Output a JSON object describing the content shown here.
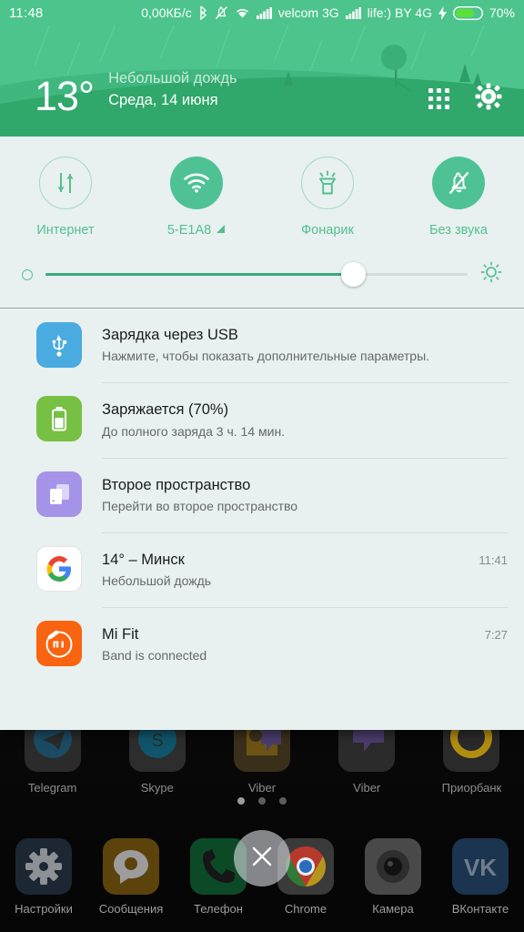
{
  "statusbar": {
    "clock": "11:48",
    "data_rate": "0,00КБ/c",
    "bluetooth_icon": "bluetooth-icon",
    "silent_icon": "bell-muted-icon",
    "wifi_icon": "wifi-icon",
    "signal1_icon": "signal-bars-icon",
    "carrier1": "velcom 3G",
    "signal2_icon": "signal-bars-icon",
    "carrier2": "life:) BY 4G",
    "charging_icon": "lightning-bolt-icon",
    "battery_icon": "battery-icon",
    "battery_percent": "70%"
  },
  "weather": {
    "temperature": "13°",
    "condition": "Небольшой дождь",
    "date": "Среда, 14 июня",
    "apps_grid_icon": "apps-grid-icon",
    "settings_icon": "gear-icon"
  },
  "quick_settings": {
    "toggles": [
      {
        "label": "Интернет",
        "icon": "data-transfer-icon",
        "state": "off"
      },
      {
        "label": "5-E1A8",
        "icon": "wifi-icon",
        "state": "on",
        "truncated": true,
        "badge_icon": "signal-triangle-icon"
      },
      {
        "label": "Фонарик",
        "icon": "flashlight-icon",
        "state": "off"
      },
      {
        "label": "Без звука",
        "icon": "bell-muted-icon",
        "state": "on"
      }
    ],
    "brightness": {
      "low_icon": "brightness-low-icon",
      "high_icon": "brightness-high-icon",
      "value_percent": 73
    }
  },
  "notifications": [
    {
      "icon": "usb-icon",
      "icon_color": "#4aabe0",
      "title": "Зарядка через USB",
      "subtitle": "Нажмите, чтобы показать дополнительные параметры.",
      "time": ""
    },
    {
      "icon": "battery-charging-icon",
      "icon_color": "#76c043",
      "title": "Заряжается (70%)",
      "subtitle": "До полного заряда 3 ч. 14 мин.",
      "time": ""
    },
    {
      "icon": "second-space-icon",
      "icon_color": "#a593e8",
      "title": "Второе пространство",
      "subtitle": "Перейти во второе пространство",
      "time": ""
    },
    {
      "icon": "google-icon",
      "icon_color": "#ffffff",
      "title": "14° – Минск",
      "subtitle": "Небольшой дождь",
      "time": "11:41"
    },
    {
      "icon": "mi-fit-icon",
      "icon_color": "#f86410",
      "title": "Mi Fit",
      "subtitle": "Band is connected",
      "time": "7:27"
    }
  ],
  "homescreen": {
    "apps_row": [
      {
        "label": "Telegram",
        "icon": "telegram-icon"
      },
      {
        "label": "Skype",
        "icon": "skype-icon"
      },
      {
        "label": "Viber",
        "icon": "viber-icon"
      },
      {
        "label": "Viber",
        "icon": "viber-icon"
      },
      {
        "label": "Приорбанк",
        "icon": "priorbank-icon"
      }
    ],
    "dock": [
      {
        "label": "Настройки",
        "icon": "gear-icon"
      },
      {
        "label": "Сообщения",
        "icon": "messages-icon"
      },
      {
        "label": "Телефон",
        "icon": "phone-icon"
      },
      {
        "label": "Chrome",
        "icon": "chrome-icon"
      },
      {
        "label": "Камера",
        "icon": "camera-icon"
      },
      {
        "label": "ВКонтакте",
        "icon": "vk-icon"
      }
    ],
    "page_dots": 3,
    "active_dot": 1
  },
  "close_button": {
    "icon": "close-icon"
  },
  "colors": {
    "accent_green": "#4ec295",
    "header_green": "#4cc48c",
    "hill_green": "#30a76b",
    "panel_bg": "#e8f0f0",
    "slider_fill": "#3aa87c"
  }
}
